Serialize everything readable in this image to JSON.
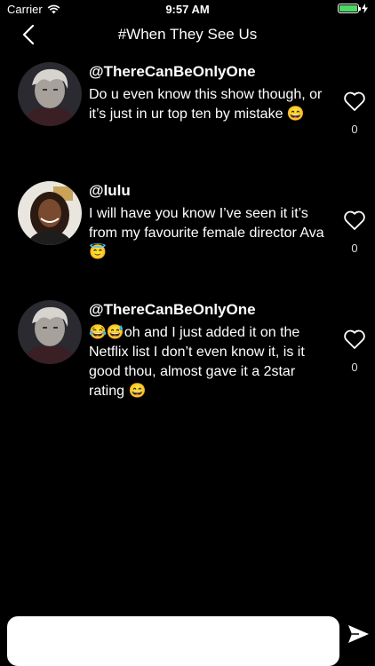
{
  "status_bar": {
    "carrier": "Carrier",
    "time": "9:57 AM"
  },
  "nav": {
    "title": "#When They See Us"
  },
  "comments": [
    {
      "username": "@ThereCanBeOnlyOne",
      "text": "Do u even know this show though, or it’s just in ur top ten by mistake 😄",
      "likes": "0",
      "avatar": "man-avatar"
    },
    {
      "username": "@lulu",
      "text": "I will have you know I’ve seen it it’s from my favourite female director Ava 😇",
      "likes": "0",
      "avatar": "woman-avatar"
    },
    {
      "username": "@ThereCanBeOnlyOne",
      "text": "😂😅oh and I just added it on the Netflix list I don’t even know it, is it good thou, almost gave it  a 2star rating 😄",
      "likes": "0",
      "avatar": "man-avatar"
    }
  ],
  "composer": {
    "value": "",
    "placeholder": ""
  },
  "colors": {
    "background": "#000000",
    "battery": "#4cd964",
    "text": "#ffffff"
  }
}
